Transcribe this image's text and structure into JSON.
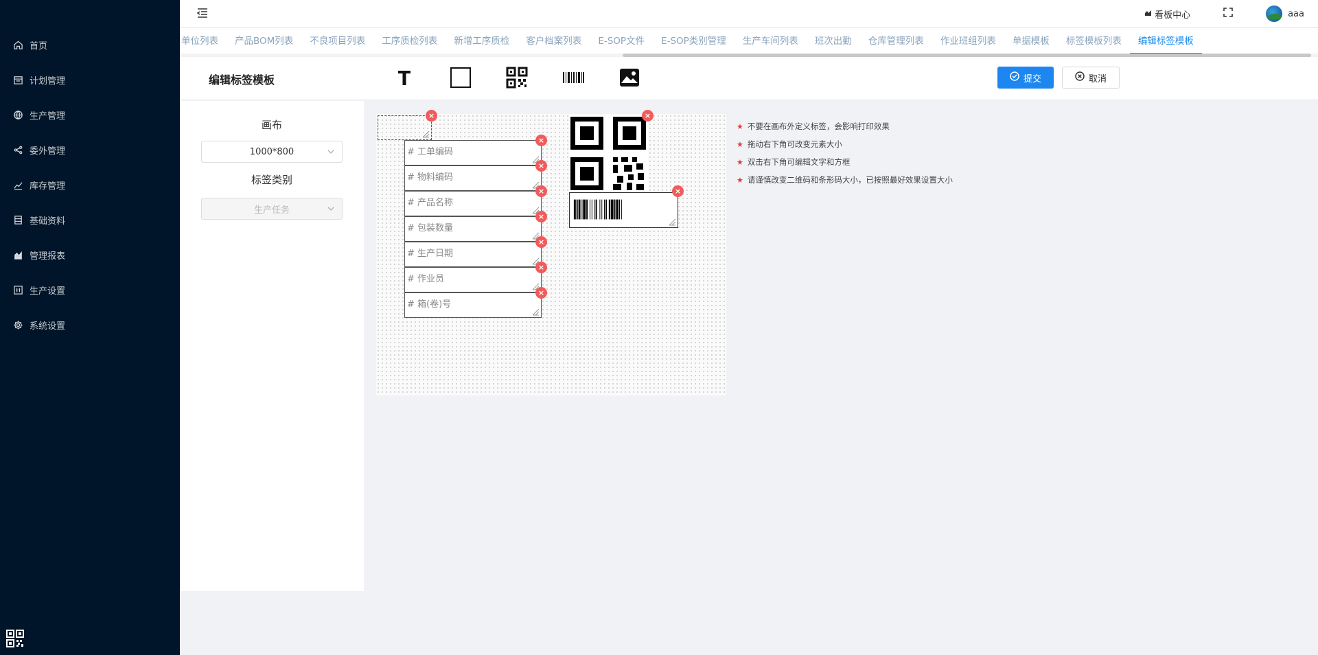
{
  "sidebar": {
    "items": [
      {
        "label": "首页",
        "icon": "home-icon"
      },
      {
        "label": "计划管理",
        "icon": "calendar-icon"
      },
      {
        "label": "生产管理",
        "icon": "globe-icon"
      },
      {
        "label": "委外管理",
        "icon": "share-icon"
      },
      {
        "label": "库存管理",
        "icon": "line-chart-icon"
      },
      {
        "label": "基础资料",
        "icon": "list-icon"
      },
      {
        "label": "管理报表",
        "icon": "bar-chart-icon"
      },
      {
        "label": "生产设置",
        "icon": "panel-icon"
      },
      {
        "label": "系统设置",
        "icon": "gear-icon"
      }
    ]
  },
  "header": {
    "kanban_label": "看板中心",
    "username": "aaa"
  },
  "tabs": [
    "单位列表",
    "产品BOM列表",
    "不良项目列表",
    "工序质检列表",
    "新增工序质检",
    "客户档案列表",
    "E-SOP文件",
    "E-SOP类别管理",
    "生产车间列表",
    "班次出勤",
    "仓库管理列表",
    "作业班组列表",
    "单据模板",
    "标签模板列表",
    "编辑标签模板"
  ],
  "active_tab": "编辑标签模板",
  "toolbar": {
    "title": "编辑标签模板",
    "submit_label": "提交",
    "cancel_label": "取消"
  },
  "left_panel": {
    "canvas_label": "画布",
    "canvas_size": "1000*800",
    "category_label": "标签类别",
    "category_value": "生产任务"
  },
  "fields": [
    "# 工单编码",
    "# 物料编码",
    "# 产品名称",
    "# 包装数量",
    "# 生产日期",
    "# 作业员",
    "# 箱(卷)号"
  ],
  "hints": [
    "不要在画布外定义标签，会影响打印效果",
    "拖动右下角可改变元素大小",
    "双击右下角可编辑文字和方框",
    "请谨慎改变二维码和条形码大小，已按照最好效果设置大小"
  ],
  "colors": {
    "sidebar_bg": "#001529",
    "accent": "#1e86f0",
    "delete": "#f25b5b",
    "hint_star": "#e53935"
  }
}
